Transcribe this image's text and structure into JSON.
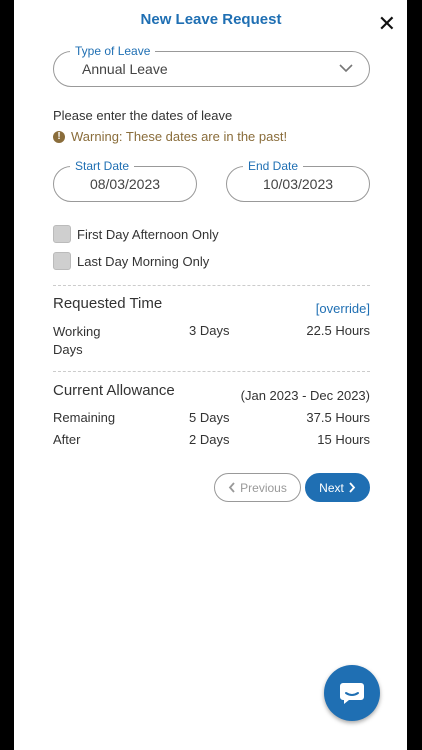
{
  "header": {
    "title": "New Leave Request",
    "close_icon": "close-icon"
  },
  "form": {
    "type_of_leave": {
      "legend": "Type of Leave",
      "value": "Annual Leave"
    },
    "dates_prompt": "Please enter the dates of leave",
    "warning": "Warning: These dates are in the past!",
    "start_date": {
      "legend": "Start Date",
      "value": "08/03/2023"
    },
    "end_date": {
      "legend": "End Date",
      "value": "10/03/2023"
    },
    "first_day_afternoon": {
      "label": "First Day Afternoon Only",
      "checked": false
    },
    "last_day_morning": {
      "label": "Last Day Morning Only",
      "checked": false
    }
  },
  "requested": {
    "heading": "Requested Time",
    "override_link": "[override]",
    "row_label_line1": "Working",
    "row_label_line2": "Days",
    "days": "3 Days",
    "hours": "22.5 Hours"
  },
  "allowance": {
    "heading": "Current Allowance",
    "period": "(Jan 2023 - Dec 2023)",
    "rows": [
      {
        "label": "Remaining",
        "days": "5 Days",
        "hours": "37.5 Hours"
      },
      {
        "label": "After",
        "days": "2 Days",
        "hours": "15 Hours"
      }
    ]
  },
  "nav": {
    "previous": "Previous",
    "next": "Next"
  },
  "colors": {
    "accent": "#1f6fb3",
    "warning": "#8a6d3b"
  }
}
